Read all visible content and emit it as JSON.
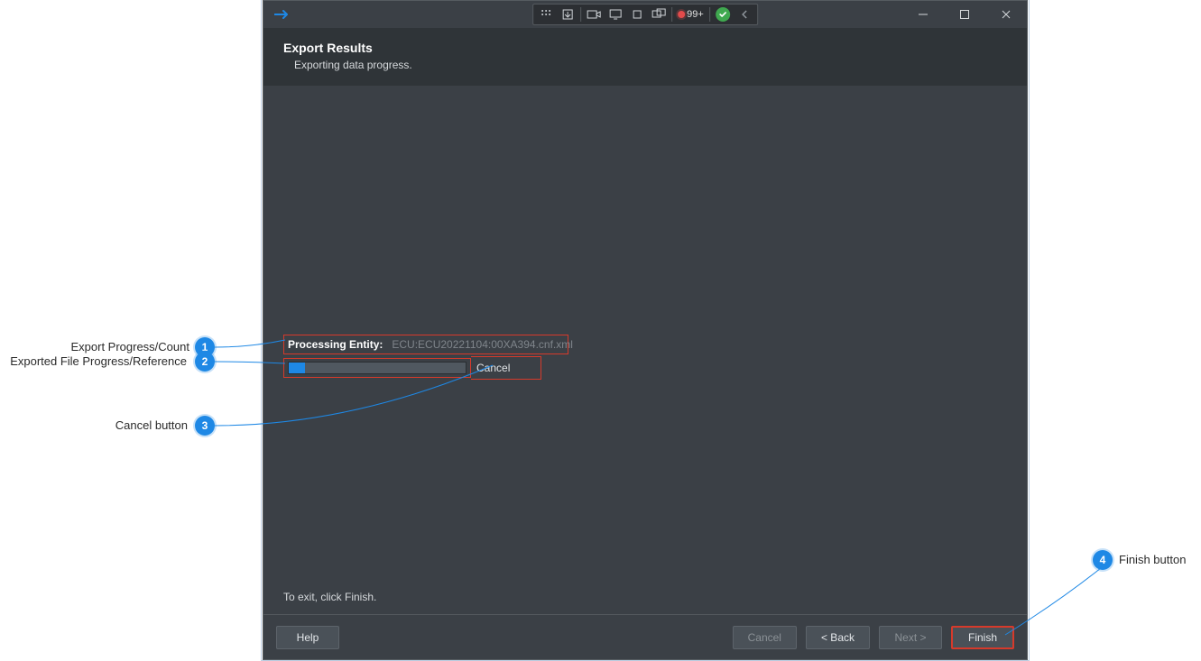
{
  "window": {
    "title": "Export Results",
    "subtitle": "Exporting data progress.",
    "toolbar_badge_count": "99+"
  },
  "progress": {
    "entity_label": "Processing Entity:",
    "entity_value": "ECU:ECU20221104:00XA394.cnf.xml",
    "cancel_label": "Cancel"
  },
  "hint": "To exit, click Finish.",
  "footer": {
    "help": "Help",
    "cancel": "Cancel",
    "back": "< Back",
    "next": "Next >",
    "finish": "Finish"
  },
  "annotations": {
    "a1": "Export Progress/Count",
    "a2": "Exported File Progress/Reference",
    "a3": "Cancel button",
    "a4": "Finish button"
  }
}
